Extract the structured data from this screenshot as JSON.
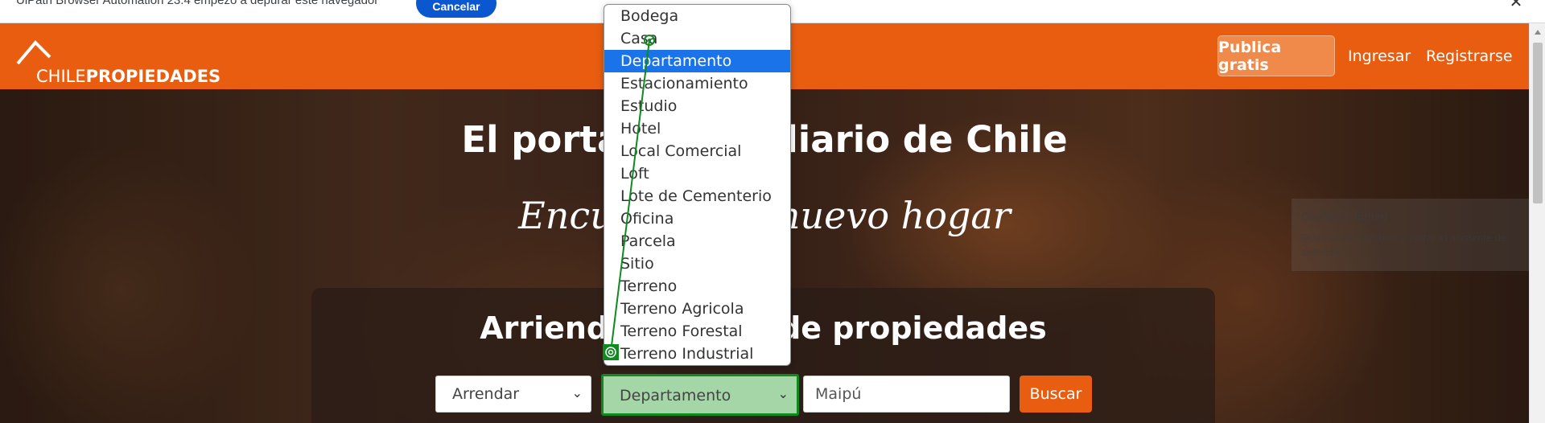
{
  "notice": {
    "text": "UiPath Browser Automation 23.4 empezó a depurar este navegador",
    "cancel_label": "Cancelar",
    "close_glyph": "✕"
  },
  "header": {
    "logo_text_light": "CHILE",
    "logo_text_bold": "PROPIEDADES",
    "publica_label": "Publica gratis",
    "ingresar_label": "Ingresar",
    "registrarse_label": "Registrarse",
    "brand_color": "#e85d0f"
  },
  "hero": {
    "title": "El portal inmobiliario de Chile",
    "subtitle": "Encuentra tu nuevo hogar",
    "search_title": "Arriendo y venta de propiedades"
  },
  "search": {
    "operacion_value": "Arrendar",
    "tipo_value": "Departamento",
    "comuna_value": "Maipú",
    "buscar_label": "Buscar"
  },
  "dropdown": {
    "items": [
      "Bodega",
      "Casa",
      "Departamento",
      "Estacionamiento",
      "Estudio",
      "Hotel",
      "Local Comercial",
      "Loft",
      "Lote de Cementerio",
      "Oficina",
      "Parcela",
      "Sitio",
      "Terreno",
      "Terreno Agricola",
      "Terreno Forestal",
      "Terreno Industrial"
    ],
    "selected_index": 2
  },
  "ghost_tooltip": {
    "title": "Confirmar (Enter)",
    "body": "Guardar los cambios y cerrar el asistente de selección."
  },
  "icons": {
    "chevron": "chevron-down-icon",
    "roof": "house-roof-icon",
    "target": "target-icon"
  }
}
